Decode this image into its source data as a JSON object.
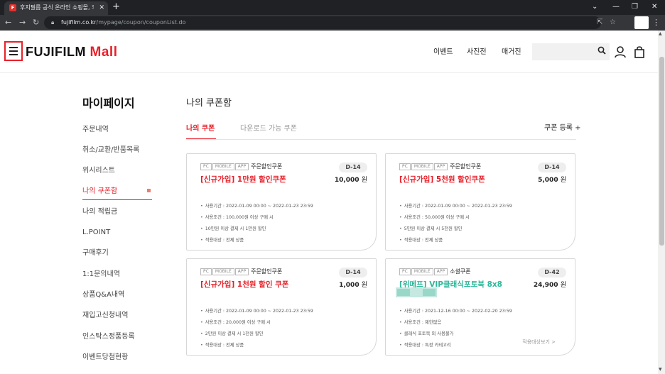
{
  "browser": {
    "tab_title": "후지필름 공식 온라인 쇼핑몰, 후",
    "tab_close": "✕",
    "new_tab": "+",
    "url_host": "fujifilm.co.kr",
    "url_path": "/mypage/coupon/couponList.do"
  },
  "header": {
    "logo_text": "FUJIFILM",
    "logo_mall": "Mall",
    "nav": [
      "이벤트",
      "사진전",
      "매거진"
    ],
    "search_placeholder": ""
  },
  "sidebar": {
    "title": "마이페이지",
    "items": [
      {
        "label": "주문내역",
        "active": false
      },
      {
        "label": "취소/교환/반품목록",
        "active": false
      },
      {
        "label": "위시리스트",
        "active": false
      },
      {
        "label": "나의 쿠폰함",
        "active": true
      },
      {
        "label": "나의 적립금",
        "active": false
      },
      {
        "label": "L.POINT",
        "active": false
      },
      {
        "label": "구매후기",
        "active": false
      },
      {
        "label": "1:1문의내역",
        "active": false
      },
      {
        "label": "상품Q&A내역",
        "active": false
      },
      {
        "label": "재입고신청내역",
        "active": false
      },
      {
        "label": "인스탁스정품등록",
        "active": false
      },
      {
        "label": "이벤트당첨현황",
        "active": false
      }
    ]
  },
  "main": {
    "title": "나의 쿠폰함",
    "tabs": [
      {
        "label": "나의 쿠폰",
        "active": true
      },
      {
        "label": "다운로드 가능 쿠폰",
        "active": false
      }
    ],
    "register_label": "쿠폰 등록 +"
  },
  "coupons": [
    {
      "platforms": [
        "PC",
        "MOBILE",
        "APP"
      ],
      "type": "주문할인쿠폰",
      "dday": "D-14",
      "name": "[신규가입] 1만원 할인쿠폰",
      "amount": "10,000",
      "unit": "원",
      "conditions": [
        "사용기간 : 2022-01-09 00:00 ~ 2022-01-23 23:59",
        "사용조건 : 100,000원 이상 구매 시",
        "10만원 이상 결제 시 1만원 할인",
        "적용대상 : 전체 상품"
      ]
    },
    {
      "platforms": [
        "PC",
        "MOBILE",
        "APP"
      ],
      "type": "주문할인쿠폰",
      "dday": "D-14",
      "name": "[신규가입] 5천원 할인쿠폰",
      "amount": "5,000",
      "unit": "원",
      "conditions": [
        "사용기간 : 2022-01-09 00:00 ~ 2022-01-23 23:59",
        "사용조건 : 50,000원 이상 구매 시",
        "5만원 이상 결제 시 5천원 할인",
        "적용대상 : 전체 상품"
      ]
    },
    {
      "platforms": [
        "PC",
        "MOBILE",
        "APP"
      ],
      "type": "주문할인쿠폰",
      "dday": "D-14",
      "name": "[신규가입] 1천원 할인 쿠폰",
      "amount": "1,000",
      "unit": "원",
      "conditions": [
        "사용기간 : 2022-01-09 00:00 ~ 2022-01-23 23:59",
        "사용조건 : 20,000원 이상 구매 시",
        "2만원 이상 결제 시 1천원 할인",
        "적용대상 : 전체 상품"
      ]
    },
    {
      "platforms": [
        "PC",
        "MOBILE",
        "APP"
      ],
      "type": "소셜쿠폰",
      "dday": "D-42",
      "name": "[위메프] VIP클래식포토북 8x8",
      "amount": "24,900",
      "unit": "원",
      "conditions": [
        "사용기간 : 2021-12-16 00:00 ~ 2022-02-20 23:59",
        "사용조건 : 제한없음",
        "클래식 포토북 외 사용불가",
        "적용대상 : 특정 카테고리"
      ],
      "detail_link": "적용대상보기 >"
    }
  ],
  "colors": {
    "brand_red": "#e8202a",
    "social_green": "#2eb89a"
  }
}
